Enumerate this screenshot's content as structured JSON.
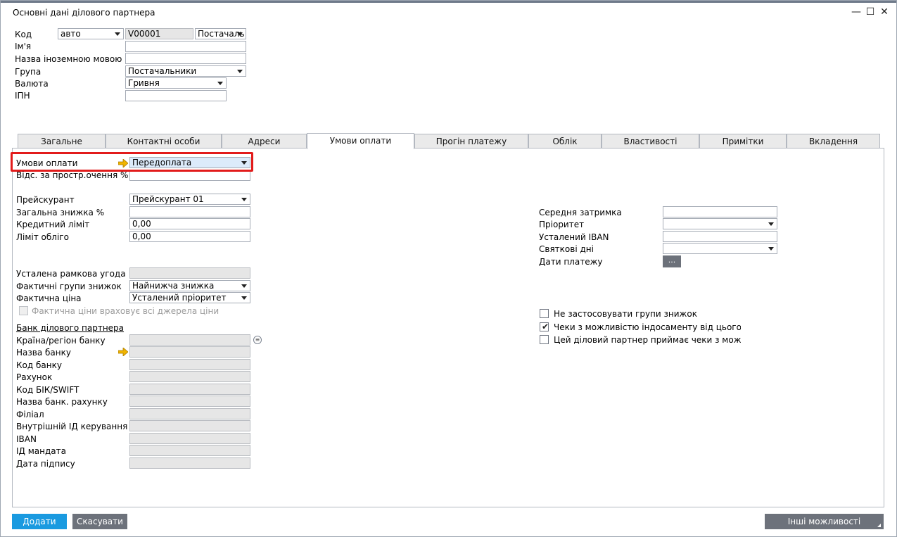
{
  "window": {
    "title": "Основні дані ділового партнера",
    "minimize": "—",
    "maximize": "☐",
    "close": "✕"
  },
  "header": {
    "code_label": "Код",
    "code_series": "авто",
    "code_value": "V00001",
    "code_type": "Постачаль",
    "name_label": "Ім'я",
    "name_value": "",
    "foreign_name_label": "Назва іноземною мовою",
    "foreign_name_value": "",
    "group_label": "Група",
    "group_value": "Постачальники",
    "currency_label": "Валюта",
    "currency_value": "Гривня",
    "tax_id_label": "ІПН",
    "tax_id_value": ""
  },
  "tabs": [
    "Загальне",
    "Контактні особи",
    "Адреси",
    "Умови оплати",
    "Прогін платежу",
    "Облік",
    "Властивості",
    "Примітки",
    "Вкладення"
  ],
  "active_tab": "Умови оплати",
  "payment": {
    "terms_label": "Умови оплати",
    "terms_value": "Передоплата",
    "overdue_label": "Відс. за простр.очення %",
    "overdue_value": "",
    "pricelist_label": "Прейскурант",
    "pricelist_value": "Прейскурант 01",
    "discount_label": "Загальна знижка %",
    "discount_value": "",
    "credit_label": "Кредитний ліміт",
    "credit_value": "0,00",
    "commit_label": "Ліміт обліго",
    "commit_value": "0,00",
    "framework_label": "Усталена рамкова угода",
    "framework_value": "",
    "eff_disc_label": "Фактичні групи знижок",
    "eff_disc_value": "Найнижча знижка",
    "eff_price_label": "Фактична ціна",
    "eff_price_value": "Усталений пріоритет",
    "eff_price_chk_label": "Фактична ціни враховує всі джерела ціни"
  },
  "bank": {
    "header": "Банк ділового партнера",
    "country_label": "Країна/регіон банку",
    "bank_name_label": "Назва банку",
    "bank_code_label": "Код банку",
    "account_label": "Рахунок",
    "swift_label": "Код БІК/SWIFT",
    "acct_name_label": "Назва банк. рахунку",
    "branch_label": "Філіал",
    "ctrl_id_label": "Внутрішній ІД керування",
    "iban_label": "IBAN",
    "mandate_label": "ІД мандата",
    "sign_date_label": "Дата підпису"
  },
  "right": {
    "avg_delay_label": "Середня затримка",
    "avg_delay_value": "",
    "priority_label": "Пріоритет",
    "priority_value": "",
    "iban_label": "Усталений IBAN",
    "iban_value": "",
    "holidays_label": "Святкові дні",
    "holidays_value": "",
    "pay_dates_label": "Дати платежу",
    "pay_dates_btn": "...",
    "chk1_label": "Не застосовувати групи знижок",
    "chk1": false,
    "chk2_label": "Чеки з можливістю індосаменту від цього діло",
    "chk2": true,
    "chk3_label": "Цей діловий партнер приймає чеки з можливі",
    "chk3": false
  },
  "buttons": {
    "add": "Додати",
    "cancel": "Скасувати",
    "more": "Інші можливості"
  },
  "colors": {
    "add_btn": "#1a9ae0",
    "cancel_btn": "#6d727b",
    "more_btn": "#6d727b",
    "highlight": "#e21b1b",
    "arrow": "#f0b400"
  }
}
